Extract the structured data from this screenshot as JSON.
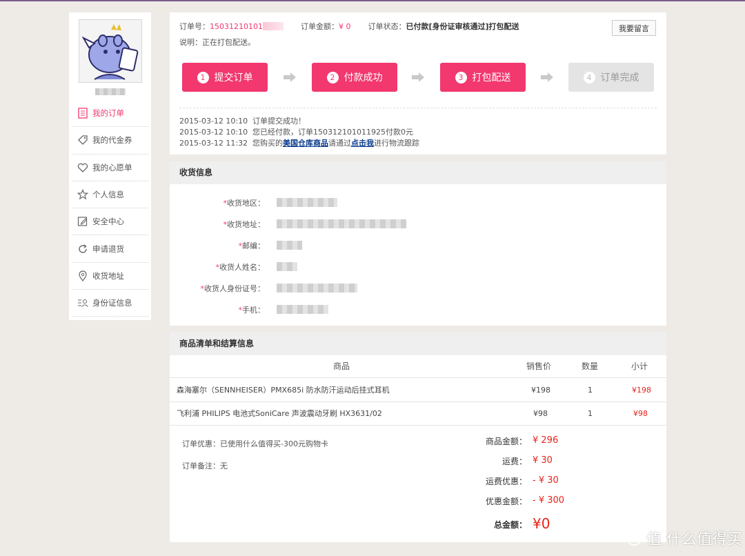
{
  "sidebar": {
    "username": "",
    "items": [
      {
        "label": "我的订单",
        "icon": "order-list-icon",
        "active": true
      },
      {
        "label": "我的代金券",
        "icon": "tag-icon",
        "active": false
      },
      {
        "label": "我的心愿单",
        "icon": "heart-icon",
        "active": false
      },
      {
        "label": "个人信息",
        "icon": "star-icon",
        "active": false
      },
      {
        "label": "安全中心",
        "icon": "edit-icon",
        "active": false
      },
      {
        "label": "申请退货",
        "icon": "refresh-icon",
        "active": false
      },
      {
        "label": "收货地址",
        "icon": "location-pin-icon",
        "active": false
      },
      {
        "label": "身份证信息",
        "icon": "id-card-icon",
        "active": false
      }
    ]
  },
  "order": {
    "number_label": "订单号：",
    "number_value": "15031210101",
    "amount_label": "订单金额：",
    "amount_value": "¥ 0",
    "status_label": "订单状态：",
    "status_value": "已付款[身份证审核通过]打包配送",
    "note": "说明：正在打包配送。",
    "message_button": "我要留言"
  },
  "steps": [
    {
      "num": "1",
      "label": "提交订单",
      "done": true
    },
    {
      "num": "2",
      "label": "付款成功",
      "done": true
    },
    {
      "num": "3",
      "label": "打包配送",
      "done": true
    },
    {
      "num": "4",
      "label": "订单完成",
      "done": false
    }
  ],
  "logs": [
    {
      "time": "2015-03-12 10:10",
      "text": "订单提交成功！"
    },
    {
      "time": "2015-03-12 10:10",
      "text": "您已经付款，订单150312101011925付款0元"
    },
    {
      "time": "2015-03-12 11:32",
      "pre": "您购买的",
      "link1": "美国仓库商品",
      "mid": "请通过",
      "link2": "点击我",
      "post": "进行物流跟踪"
    }
  ],
  "shipping": {
    "title": "收货信息",
    "fields": [
      {
        "label": "收货地区："
      },
      {
        "label": "收货地址："
      },
      {
        "label": "邮编："
      },
      {
        "label": "收货人姓名："
      },
      {
        "label": "收货人身份证号："
      },
      {
        "label": "手机："
      }
    ]
  },
  "goods": {
    "title": "商品清单和结算信息",
    "columns": {
      "product": "商品",
      "price": "销售价",
      "qty": "数量",
      "subtotal": "小计"
    },
    "rows": [
      {
        "product": "森海塞尔（SENNHEISER）PMX685i 防水防汗运动后挂式耳机",
        "price": "¥198",
        "qty": "1",
        "subtotal": "¥198"
      },
      {
        "product": "飞利浦 PHILIPS 电池式SoniCare 声波震动牙刷 HX3631/02",
        "price": "¥98",
        "qty": "1",
        "subtotal": "¥98"
      }
    ],
    "discount_note": "订单优惠：已使用什么值得买-300元购物卡",
    "remark": "订单备注：无",
    "summary": [
      {
        "label": "商品金额：",
        "value": "¥ 296"
      },
      {
        "label": "运费：",
        "value": "¥ 30"
      },
      {
        "label": "运费优惠：",
        "value": "- ¥ 30"
      },
      {
        "label": "优惠金额：",
        "value": "- ¥ 300"
      }
    ],
    "total_label": "总金额：",
    "total_value": "¥0"
  },
  "watermark": "值 什么值得买",
  "colors": {
    "accent": "#f2386f",
    "price_red": "#e8221b",
    "link_blue": "#0b3a8e"
  }
}
